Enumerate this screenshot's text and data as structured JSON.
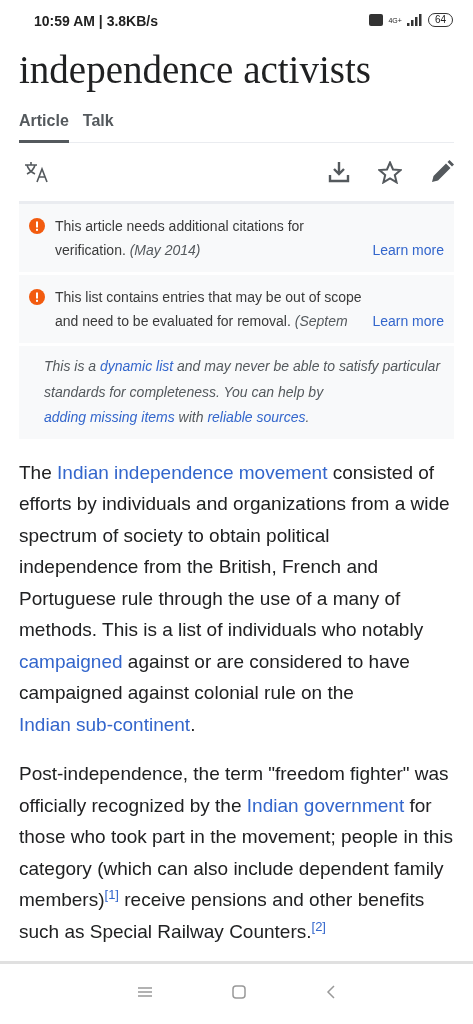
{
  "status_bar": {
    "time": "10:59 AM | 3.8KB/s",
    "network": "4G+",
    "battery": "64"
  },
  "title": {
    "line": "independence activists"
  },
  "tabs": [
    {
      "label": "Article",
      "selected": true
    },
    {
      "label": "Talk",
      "selected": false
    }
  ],
  "notices": [
    {
      "kind": "issue",
      "text": "This article needs additional citations for verification.",
      "date": "(May 2014)",
      "link": "Learn more"
    },
    {
      "kind": "issue",
      "text": "This list contains entries that may be out of scope and need to be evaluated for removal.",
      "date": "(Septem",
      "link": "Learn more"
    },
    {
      "kind": "note",
      "segments": [
        {
          "kind": "text",
          "text": "This is a "
        },
        {
          "kind": "link",
          "text": "dynamic list"
        },
        {
          "kind": "text",
          "text": " and may never be able to satisfy particular standards for completeness. You can help by "
        },
        {
          "kind": "link",
          "text": "adding missing items"
        },
        {
          "kind": "text",
          "text": " with "
        },
        {
          "kind": "link",
          "text": "reliable sources"
        },
        {
          "kind": "text",
          "text": "."
        }
      ]
    }
  ],
  "paragraphs": [
    [
      {
        "kind": "text",
        "text": "The "
      },
      {
        "kind": "link",
        "text": "Indian independence movement"
      },
      {
        "kind": "text",
        "text": " consisted of efforts by individuals and organizations from a wide spectrum of society to obtain political independence from the British, French and Portuguese rule through the use of a many of methods. This is a list of individuals who notably "
      },
      {
        "kind": "link",
        "text": "campaigned"
      },
      {
        "kind": "text",
        "text": " against or are considered to have campaigned against colonial rule on the "
      },
      {
        "kind": "link",
        "text": "Indian sub-continent"
      },
      {
        "kind": "text",
        "text": "."
      }
    ],
    [
      {
        "kind": "text",
        "text": "Post-independence, the term \"freedom fighter\" was officially recognized by the "
      },
      {
        "kind": "link",
        "text": "Indian government"
      },
      {
        "kind": "text",
        "text": " for those who took part in the movement; people in this category (which can also include dependent family members)"
      },
      {
        "kind": "ref",
        "text": "[1]"
      },
      {
        "kind": "text",
        "text": " receive pensions and other benefits such as Special Railway Counters."
      },
      {
        "kind": "ref",
        "text": "[2]"
      }
    ]
  ]
}
